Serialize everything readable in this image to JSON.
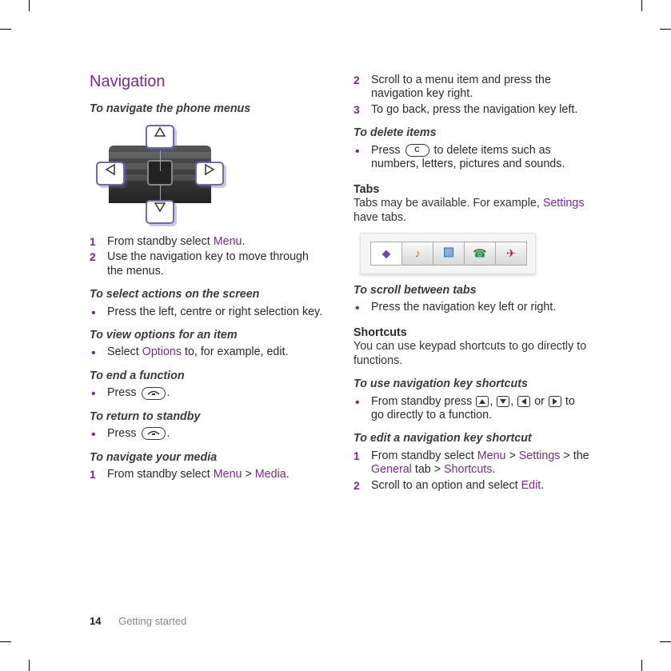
{
  "page": {
    "number": "14",
    "section": "Getting started"
  },
  "left": {
    "heading": "Navigation",
    "sub_navigate": "To navigate the phone menus",
    "steps_navigate": [
      {
        "n": "1",
        "pre": "From standby select ",
        "link": "Menu",
        "post": "."
      },
      {
        "n": "2",
        "pre": "Use the navigation key to move through the menus.",
        "link": "",
        "post": ""
      }
    ],
    "sub_select": "To select actions on the screen",
    "bul_select": "Press the left, centre or right selection key.",
    "sub_view": "To view options for an item",
    "bul_view_pre": "Select ",
    "bul_view_link": "Options",
    "bul_view_post": " to, for example, edit.",
    "sub_end": "To end a function",
    "bul_end": "Press ",
    "sub_return": "To return to standby",
    "bul_return": "Press ",
    "sub_media": "To navigate your media",
    "step_media_n": "1",
    "step_media_pre": "From standby select ",
    "step_media_l1": "Menu",
    "step_media_sep": " > ",
    "step_media_l2": "Media",
    "step_media_post": "."
  },
  "right": {
    "steps_top": [
      {
        "n": "2",
        "t": "Scroll to a menu item and press the navigation key right."
      },
      {
        "n": "3",
        "t": "To go back, press the navigation key left."
      }
    ],
    "sub_delete": "To delete items",
    "bul_delete_pre": "Press ",
    "bul_delete_post": " to delete items such as numbers, letters, pictures and sounds.",
    "tabs_head": "Tabs",
    "tabs_para_pre": "Tabs may be available. For example, ",
    "tabs_para_link": "Settings",
    "tabs_para_post": " have tabs.",
    "sub_scroll": "To scroll between tabs",
    "bul_scroll": "Press the navigation key left or right.",
    "shortcuts_head": "Shortcuts",
    "shortcuts_para": "You can use keypad shortcuts to go directly to functions.",
    "sub_use": "To use navigation key shortcuts",
    "bul_use_pre": "From standby press ",
    "bul_use_mid1": ", ",
    "bul_use_mid2": ", ",
    "bul_use_mid3": " or ",
    "bul_use_post": " to go directly to a function.",
    "sub_edit": "To edit a navigation key shortcut",
    "steps_edit": [
      {
        "n": "1",
        "pre": "From standby select ",
        "l1": "Menu",
        "s1": " > ",
        "l2": "Settings",
        "s2": " > the ",
        "l3": "General",
        "s3": " tab > ",
        "l4": "Shortcuts",
        "post": "."
      },
      {
        "n": "2",
        "pre": "Scroll to an option and select ",
        "l1": "Edit",
        "post": "."
      }
    ]
  },
  "icons": {
    "end_key": "end-call-key-icon",
    "c_key": "C",
    "nav_up": "▲",
    "nav_down": "▼",
    "nav_left": "◀",
    "nav_right": "▶"
  }
}
